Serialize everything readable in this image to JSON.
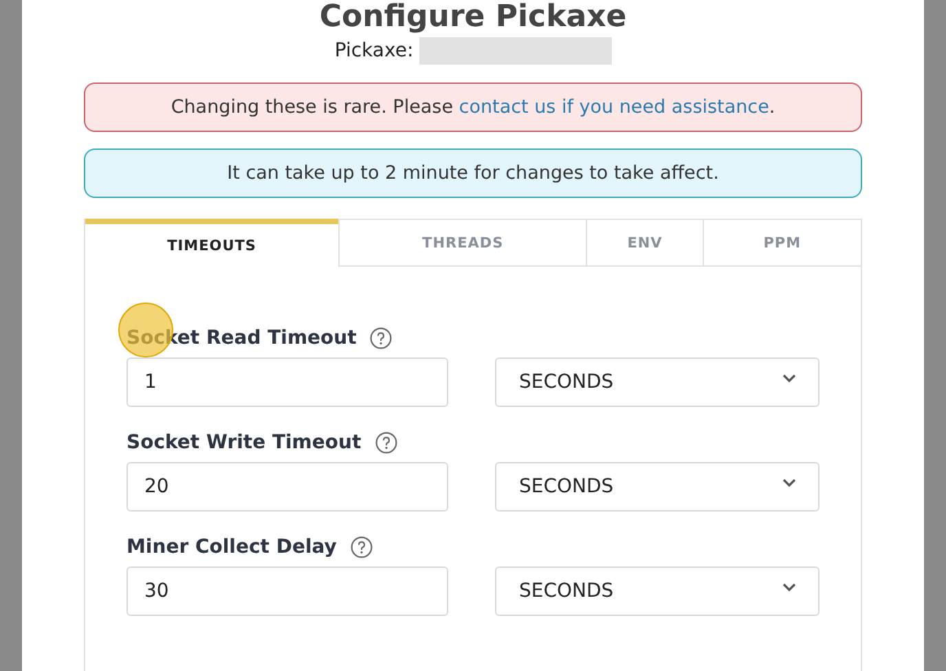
{
  "dialog": {
    "title": "Configure Pickaxe",
    "subtitle_label": "Pickaxe:"
  },
  "alerts": [
    {
      "kind": "danger",
      "text": "Changing these is rare. Please ",
      "link": "contact us if you need assistance",
      "after": "."
    },
    {
      "kind": "info",
      "text": "It can take up to 2 minute for changes to take affect."
    }
  ],
  "tabs": [
    {
      "label": "TIMEOUTS",
      "selected": true
    },
    {
      "label": "THREADS",
      "selected": false
    },
    {
      "label": "ENV",
      "selected": false
    },
    {
      "label": "PPM",
      "selected": false
    }
  ],
  "fields": [
    {
      "label": "Socket Read Timeout",
      "value": "1",
      "unit": "SECONDS"
    },
    {
      "label": "Socket Write Timeout",
      "value": "20",
      "unit": "SECONDS"
    },
    {
      "label": "Miner Collect Delay",
      "value": "30",
      "unit": "SECONDS"
    }
  ]
}
